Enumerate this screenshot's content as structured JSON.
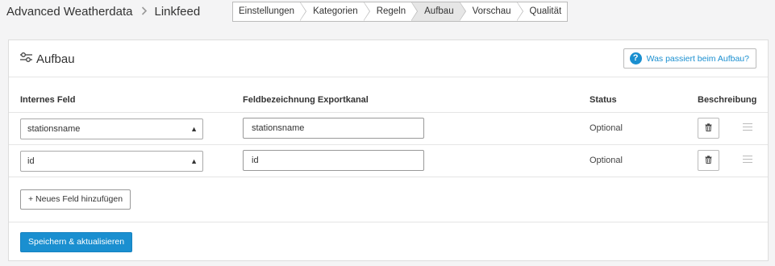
{
  "breadcrumb": {
    "app": "Advanced Weatherdata",
    "page": "Linkfeed"
  },
  "steps": [
    {
      "label": "Einstellungen",
      "active": false
    },
    {
      "label": "Kategorien",
      "active": false
    },
    {
      "label": "Regeln",
      "active": false
    },
    {
      "label": "Aufbau",
      "active": true
    },
    {
      "label": "Vorschau",
      "active": false
    },
    {
      "label": "Qualität",
      "active": false
    }
  ],
  "panel": {
    "title": "Aufbau",
    "help_label": "Was passiert beim Aufbau?"
  },
  "columns": {
    "internal": "Internes Feld",
    "export": "Feldbezeichnung Exportkanal",
    "status": "Status",
    "description": "Beschreibung"
  },
  "rows": [
    {
      "internal": "stationsname",
      "export": "stationsname",
      "status": "Optional"
    },
    {
      "internal": "id",
      "export": "id",
      "status": "Optional"
    }
  ],
  "actions": {
    "add_label": "+ Neues Feld hinzufügen",
    "save_label": "Speichern & aktualisieren"
  },
  "colors": {
    "accent": "#1a8fd0"
  }
}
